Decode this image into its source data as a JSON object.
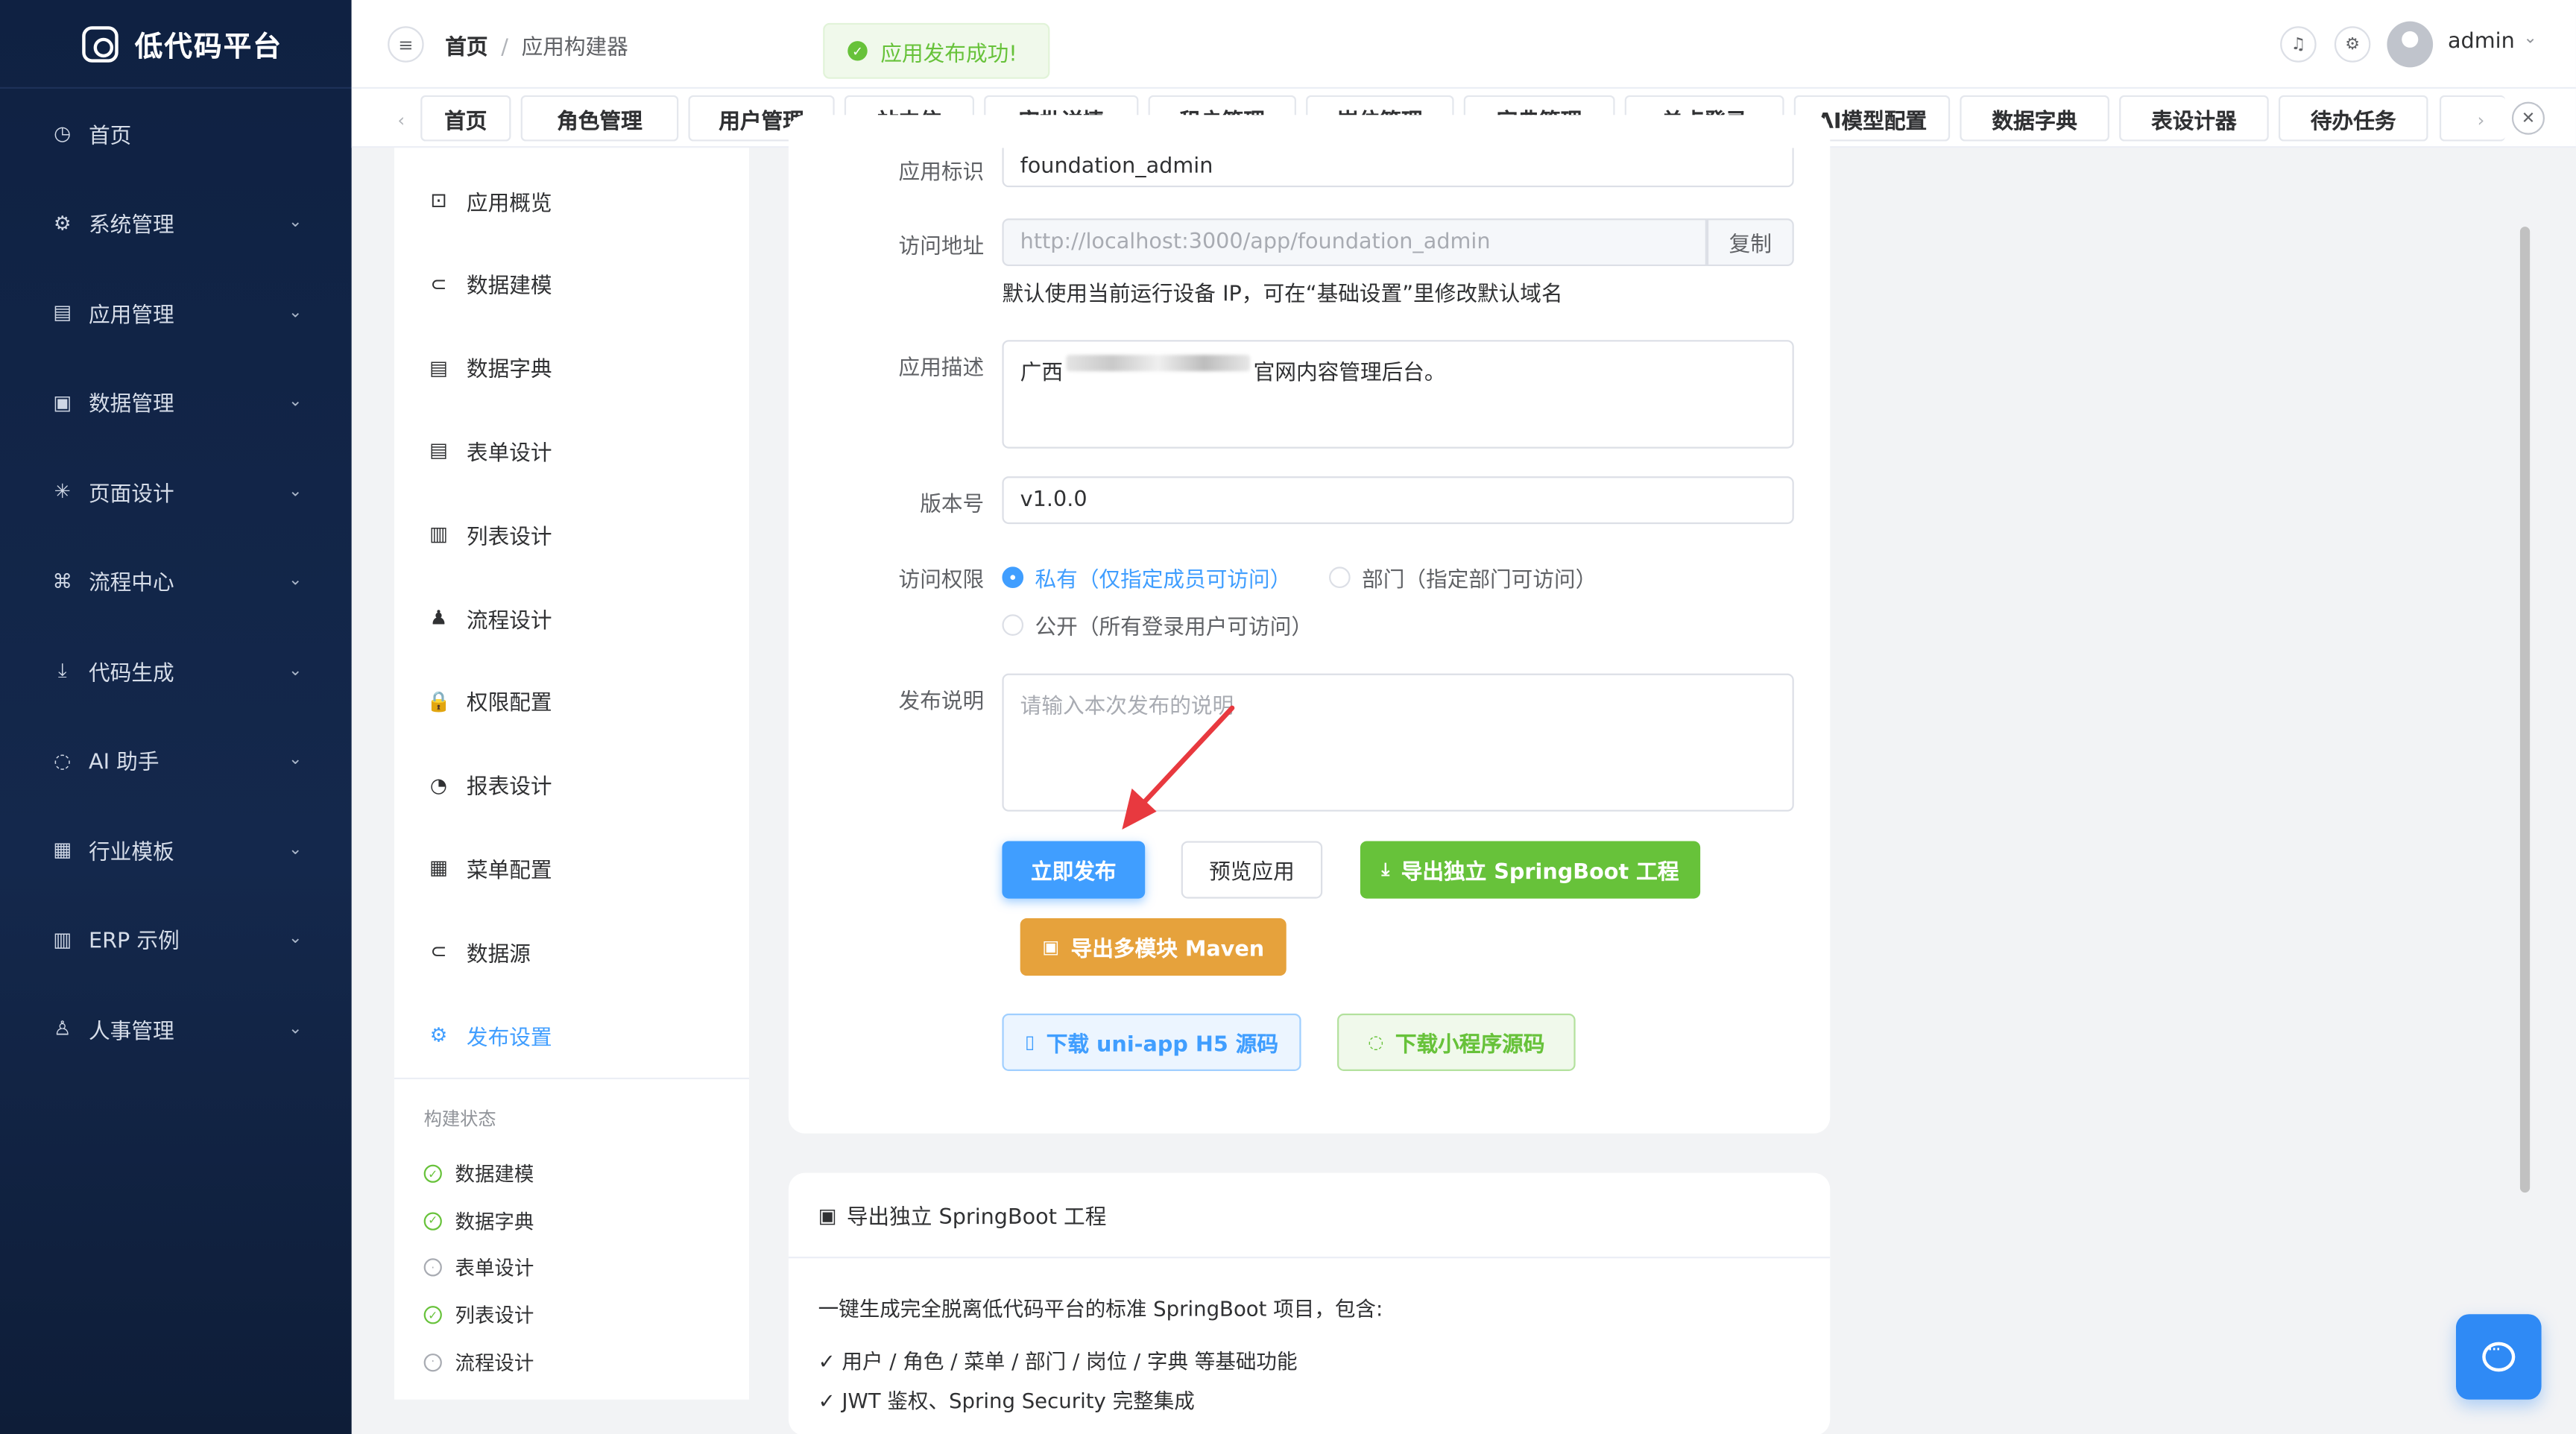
{
  "app": {
    "brand": "低代码平台"
  },
  "sidebar": {
    "items": [
      {
        "label": "首页",
        "icon": "dashboard-icon",
        "glyph": "◷",
        "chev": false
      },
      {
        "label": "系统管理",
        "icon": "gear-icon",
        "glyph": "⚙",
        "chev": true
      },
      {
        "label": "应用管理",
        "icon": "document-icon",
        "glyph": "▤",
        "chev": true
      },
      {
        "label": "数据管理",
        "icon": "monitor-icon",
        "glyph": "▣",
        "chev": true
      },
      {
        "label": "页面设计",
        "icon": "sparkle-icon",
        "glyph": "✳",
        "chev": true
      },
      {
        "label": "流程中心",
        "icon": "flow-icon",
        "glyph": "⌘",
        "chev": true
      },
      {
        "label": "代码生成",
        "icon": "download-icon",
        "glyph": "⤓",
        "chev": true
      },
      {
        "label": "AI 助手",
        "icon": "chat-icon",
        "glyph": "◌",
        "chev": true
      },
      {
        "label": "行业模板",
        "icon": "grid-icon",
        "glyph": "▦",
        "chev": true
      },
      {
        "label": "ERP 示例",
        "icon": "building-icon",
        "glyph": "▥",
        "chev": true
      },
      {
        "label": "人事管理",
        "icon": "user-icon",
        "glyph": "♙",
        "chev": true
      }
    ]
  },
  "header": {
    "breadcrumb": [
      "首页",
      "应用构建器"
    ],
    "toast": "应用发布成功!",
    "username": "admin"
  },
  "tabs": [
    "首页",
    "角色管理",
    "用户管理",
    "站内信",
    "审批详情",
    "租户管理",
    "岗位管理",
    "字典管理",
    "单点登录",
    "AI模型配置",
    "数据字典",
    "表设计器",
    "待办任务"
  ],
  "submenu": {
    "items": [
      {
        "label": "应用概览",
        "icon": "presentation-icon",
        "glyph": "⊡",
        "active": false
      },
      {
        "label": "数据建模",
        "icon": "link-icon",
        "glyph": "⊂",
        "active": false
      },
      {
        "label": "数据字典",
        "icon": "document-icon",
        "glyph": "▤",
        "active": false
      },
      {
        "label": "表单设计",
        "icon": "form-icon",
        "glyph": "▤",
        "active": false
      },
      {
        "label": "列表设计",
        "icon": "clipboard-icon",
        "glyph": "▥",
        "active": false
      },
      {
        "label": "流程设计",
        "icon": "stamp-icon",
        "glyph": "♟",
        "active": false
      },
      {
        "label": "权限配置",
        "icon": "lock-icon",
        "glyph": "🔒",
        "active": false
      },
      {
        "label": "报表设计",
        "icon": "pie-chart-icon",
        "glyph": "◔",
        "active": false
      },
      {
        "label": "菜单配置",
        "icon": "grid-icon",
        "glyph": "▦",
        "active": false
      },
      {
        "label": "数据源",
        "icon": "link-icon",
        "glyph": "⊂",
        "active": false
      },
      {
        "label": "发布设置",
        "icon": "gear-icon",
        "glyph": "⚙",
        "active": true
      }
    ],
    "build_status_title": "构建状态",
    "build_status": [
      {
        "label": "数据建模",
        "done": true
      },
      {
        "label": "数据字典",
        "done": true
      },
      {
        "label": "表单设计",
        "done": false
      },
      {
        "label": "列表设计",
        "done": true
      },
      {
        "label": "流程设计",
        "done": false
      }
    ]
  },
  "form": {
    "app_id_label": "应用标识",
    "app_id_value": "foundation_admin",
    "url_label": "访问地址",
    "url_value": "http://localhost:3000/app/foundation_admin",
    "copy_label": "复制",
    "url_help": "默认使用当前运行设备 IP，可在“基础设置”里修改默认域名",
    "desc_label": "应用描述",
    "desc_prefix": "广西",
    "desc_suffix": "官网内容管理后台。",
    "version_label": "版本号",
    "version_value": "v1.0.0",
    "access_label": "访问权限",
    "access_options": [
      {
        "label": "私有（仅指定成员可访问）",
        "checked": true
      },
      {
        "label": "部门（指定部门可访问）",
        "checked": false
      },
      {
        "label": "公开（所有登录用户可访问）",
        "checked": false
      }
    ],
    "notes_label": "发布说明",
    "notes_placeholder": "请输入本次发布的说明",
    "buttons": {
      "publish": "立即发布",
      "preview": "预览应用",
      "export_springboot": "导出独立 SpringBoot 工程",
      "export_maven": "导出多模块 Maven",
      "download_h5": "下载 uni-app H5 源码",
      "download_mp": "下载小程序源码"
    }
  },
  "export_card": {
    "title": "导出独立 SpringBoot 工程",
    "intro": "一键生成完全脱离低代码平台的标准 SpringBoot 项目，包含:",
    "features": [
      "✓ 用户 / 角色 / 菜单 / 部门 / 岗位 / 字典 等基础功能",
      "✓ JWT 鉴权、Spring Security 完整集成"
    ]
  },
  "colors": {
    "sidebar_bg": "#0f2142",
    "primary": "#409eff",
    "success": "#67c23a",
    "warning": "#e6a23c",
    "annotation_arrow": "#e8393f"
  }
}
